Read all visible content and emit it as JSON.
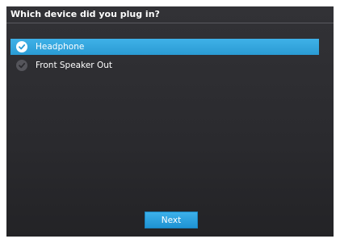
{
  "dialog": {
    "title": "Which device did you plug in?"
  },
  "options": [
    {
      "label": "Headphone",
      "selected": true,
      "icon": "check-icon"
    },
    {
      "label": "Front Speaker Out",
      "selected": false,
      "icon": "check-icon"
    }
  ],
  "buttons": {
    "next_label": "Next"
  },
  "colors": {
    "accent": "#2a9bd4",
    "background": "#2b2b2f",
    "text": "#ffffff"
  }
}
